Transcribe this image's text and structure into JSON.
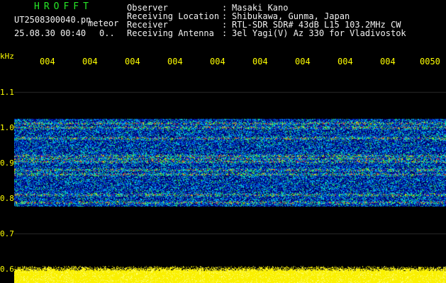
{
  "header": {
    "app_title": "HROFFT",
    "filename": "UT2508300040.pn",
    "meteor_label": "meteor",
    "datetime": "25.08.30 00:40",
    "count": "0..",
    "fields": [
      {
        "label": "Observer",
        "value": "Masaki Kano"
      },
      {
        "label": "Receiving Location",
        "value": "Shibukawa, Gunma, Japan"
      },
      {
        "label": "Receiver",
        "value": "RTL-SDR SDR# 43dB L15 103.2MHz CW"
      },
      {
        "label": "Receiving Antenna",
        "value": "3el Yagi(V) Az 330 for Vladivostok"
      }
    ]
  },
  "axis": {
    "y_unit": "kHz",
    "y_ticks": [
      "1.1",
      "1.0",
      "0.9",
      "0.8",
      "0.7",
      "0.6"
    ],
    "x_ticks": [
      "004",
      "004",
      "004",
      "004",
      "004",
      "004",
      "004",
      "004",
      "004",
      "0050"
    ]
  },
  "colors": {
    "background": "#000000",
    "header_text": "#f2f2f2",
    "title_green": "#27e627",
    "tick_yellow": "#ffff00"
  }
}
